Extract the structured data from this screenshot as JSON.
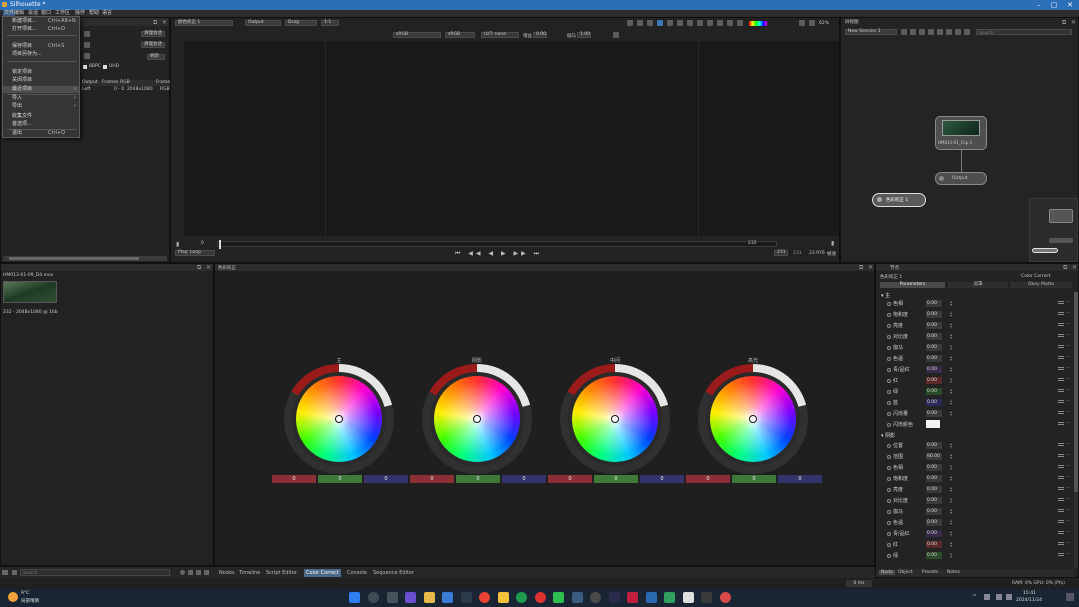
{
  "app": {
    "title": "Silhouette *",
    "window_controls": [
      "–",
      "▢",
      "✕"
    ]
  },
  "menubar": [
    "文件",
    "编辑",
    "会话",
    "窗口",
    "工作区",
    "操作",
    "帮助",
    "语言"
  ],
  "file_menu": {
    "items": [
      {
        "label": "新建项目...",
        "shortcut": "Ctrl+Alt+N"
      },
      {
        "label": "打开项目...",
        "shortcut": "Ctrl+O"
      },
      {
        "label": "保存项目",
        "shortcut": "Ctrl+S"
      },
      {
        "label": "项目另存为...",
        "shortcut": ""
      },
      {
        "label": "锁定项目",
        "shortcut": ""
      },
      {
        "label": "关闭项目",
        "shortcut": ""
      },
      {
        "label": "最近项目",
        "shortcut": "",
        "submenu": true
      },
      {
        "label": "导入",
        "shortcut": "",
        "submenu": true
      },
      {
        "label": "导出",
        "shortcut": "",
        "submenu": true
      },
      {
        "label": "收集文件",
        "shortcut": ""
      },
      {
        "label": "首选项...",
        "shortcut": ""
      },
      {
        "label": "退出",
        "shortcut": "Ctrl+Q"
      }
    ]
  },
  "project_panel": {
    "buttons": [
      "清理会话",
      "清理会话",
      "刷新"
    ],
    "checkboxes": [
      "8BPC",
      "UHD"
    ],
    "table_headers": [
      "Output",
      "Frames",
      "RGB",
      "Frame"
    ],
    "table_row": [
      "Left",
      "0 - 0",
      "2048x1080",
      "RGB"
    ]
  },
  "viewer_toolbar": {
    "session": "颜色校正 1",
    "output": "Output",
    "mode": "Drag",
    "ratio": "1:1",
    "zoom": "62%",
    "colorspace_a": "sRGB",
    "colorspace_b": "sRGB",
    "lut": "LUT: none",
    "gain_label": "增益",
    "gain_value": "0.00",
    "gamma_label": "伽马",
    "gamma_value": "1.00"
  },
  "timeline": {
    "start": "0",
    "end": "232",
    "fps": "23.976",
    "current": "231",
    "play_mode": "Play: Loop",
    "speed_label": "帧速"
  },
  "trees": {
    "title": "树视图",
    "dropdown": "New Session 1",
    "search_placeholder": "Search",
    "nodes": [
      {
        "name": "HM013-01_Clip-1"
      },
      {
        "name": "Output"
      },
      {
        "name": "色彩校正 1"
      }
    ]
  },
  "media": {
    "file": "HM013-01-09_D4.mov",
    "info": "232 - 2048x1080 @ 16b"
  },
  "color_panel": {
    "title": "色彩校正",
    "wheels": [
      {
        "label": "主",
        "channels": [
          "0",
          "0",
          "0"
        ]
      },
      {
        "label": "阴影",
        "channels": [
          "0",
          "0",
          "0"
        ]
      },
      {
        "label": "中间",
        "channels": [
          "0",
          "0",
          "0"
        ]
      },
      {
        "label": "高光",
        "channels": [
          "0",
          "0",
          "0"
        ]
      }
    ]
  },
  "nodes_panel": {
    "title": "节点",
    "node_name": "色彩校正 1",
    "node_type": "Color Correct",
    "tabs": [
      "Parameters",
      "遮罩",
      "Obey Matte"
    ],
    "section_a": "主",
    "section_b": "阴影",
    "rows_a": [
      {
        "label": "色相",
        "value": "0.00"
      },
      {
        "label": "饱和度",
        "value": "0.00"
      },
      {
        "label": "亮度",
        "value": "0.00"
      },
      {
        "label": "对比度",
        "value": "0.00"
      },
      {
        "label": "伽马",
        "value": "0.00"
      },
      {
        "label": "色温",
        "value": "0.00"
      },
      {
        "label": "青/品红",
        "value": "0.00"
      },
      {
        "label": "红",
        "value": "0.00"
      },
      {
        "label": "绿",
        "value": "0.00"
      },
      {
        "label": "蓝",
        "value": "0.00"
      },
      {
        "label": "闪烁量",
        "value": "0.00"
      },
      {
        "label": "闪烁颜色",
        "value": ""
      }
    ],
    "rows_b": [
      {
        "label": "位置",
        "value": "0.00"
      },
      {
        "label": "范围",
        "value": "80.00"
      },
      {
        "label": "色相",
        "value": "0.00"
      },
      {
        "label": "饱和度",
        "value": "0.00"
      },
      {
        "label": "亮度",
        "value": "0.00"
      },
      {
        "label": "对比度",
        "value": "0.00"
      },
      {
        "label": "伽马",
        "value": "0.00"
      },
      {
        "label": "色温",
        "value": "0.00"
      },
      {
        "label": "青/品红",
        "value": "0.00"
      },
      {
        "label": "红",
        "value": "0.00"
      },
      {
        "label": "绿",
        "value": "0.00"
      }
    ],
    "bottom_tabs": [
      "Node",
      "Object",
      "Presets",
      "Notes"
    ]
  },
  "bottom_tabs": [
    "Nodes",
    "Timeline",
    "Script Editor",
    "Color Correct",
    "Console",
    "Sequence Editor"
  ],
  "bottom_search_placeholder": "Search",
  "status": {
    "frame_readout": "0 ms",
    "right": "RAM: 0%  GPU: 0%  (Pfx)"
  },
  "taskbar": {
    "weather_temp": "9°C",
    "weather_desc": "局部晴朗",
    "time": "15:41",
    "date": "2024/11/24"
  }
}
